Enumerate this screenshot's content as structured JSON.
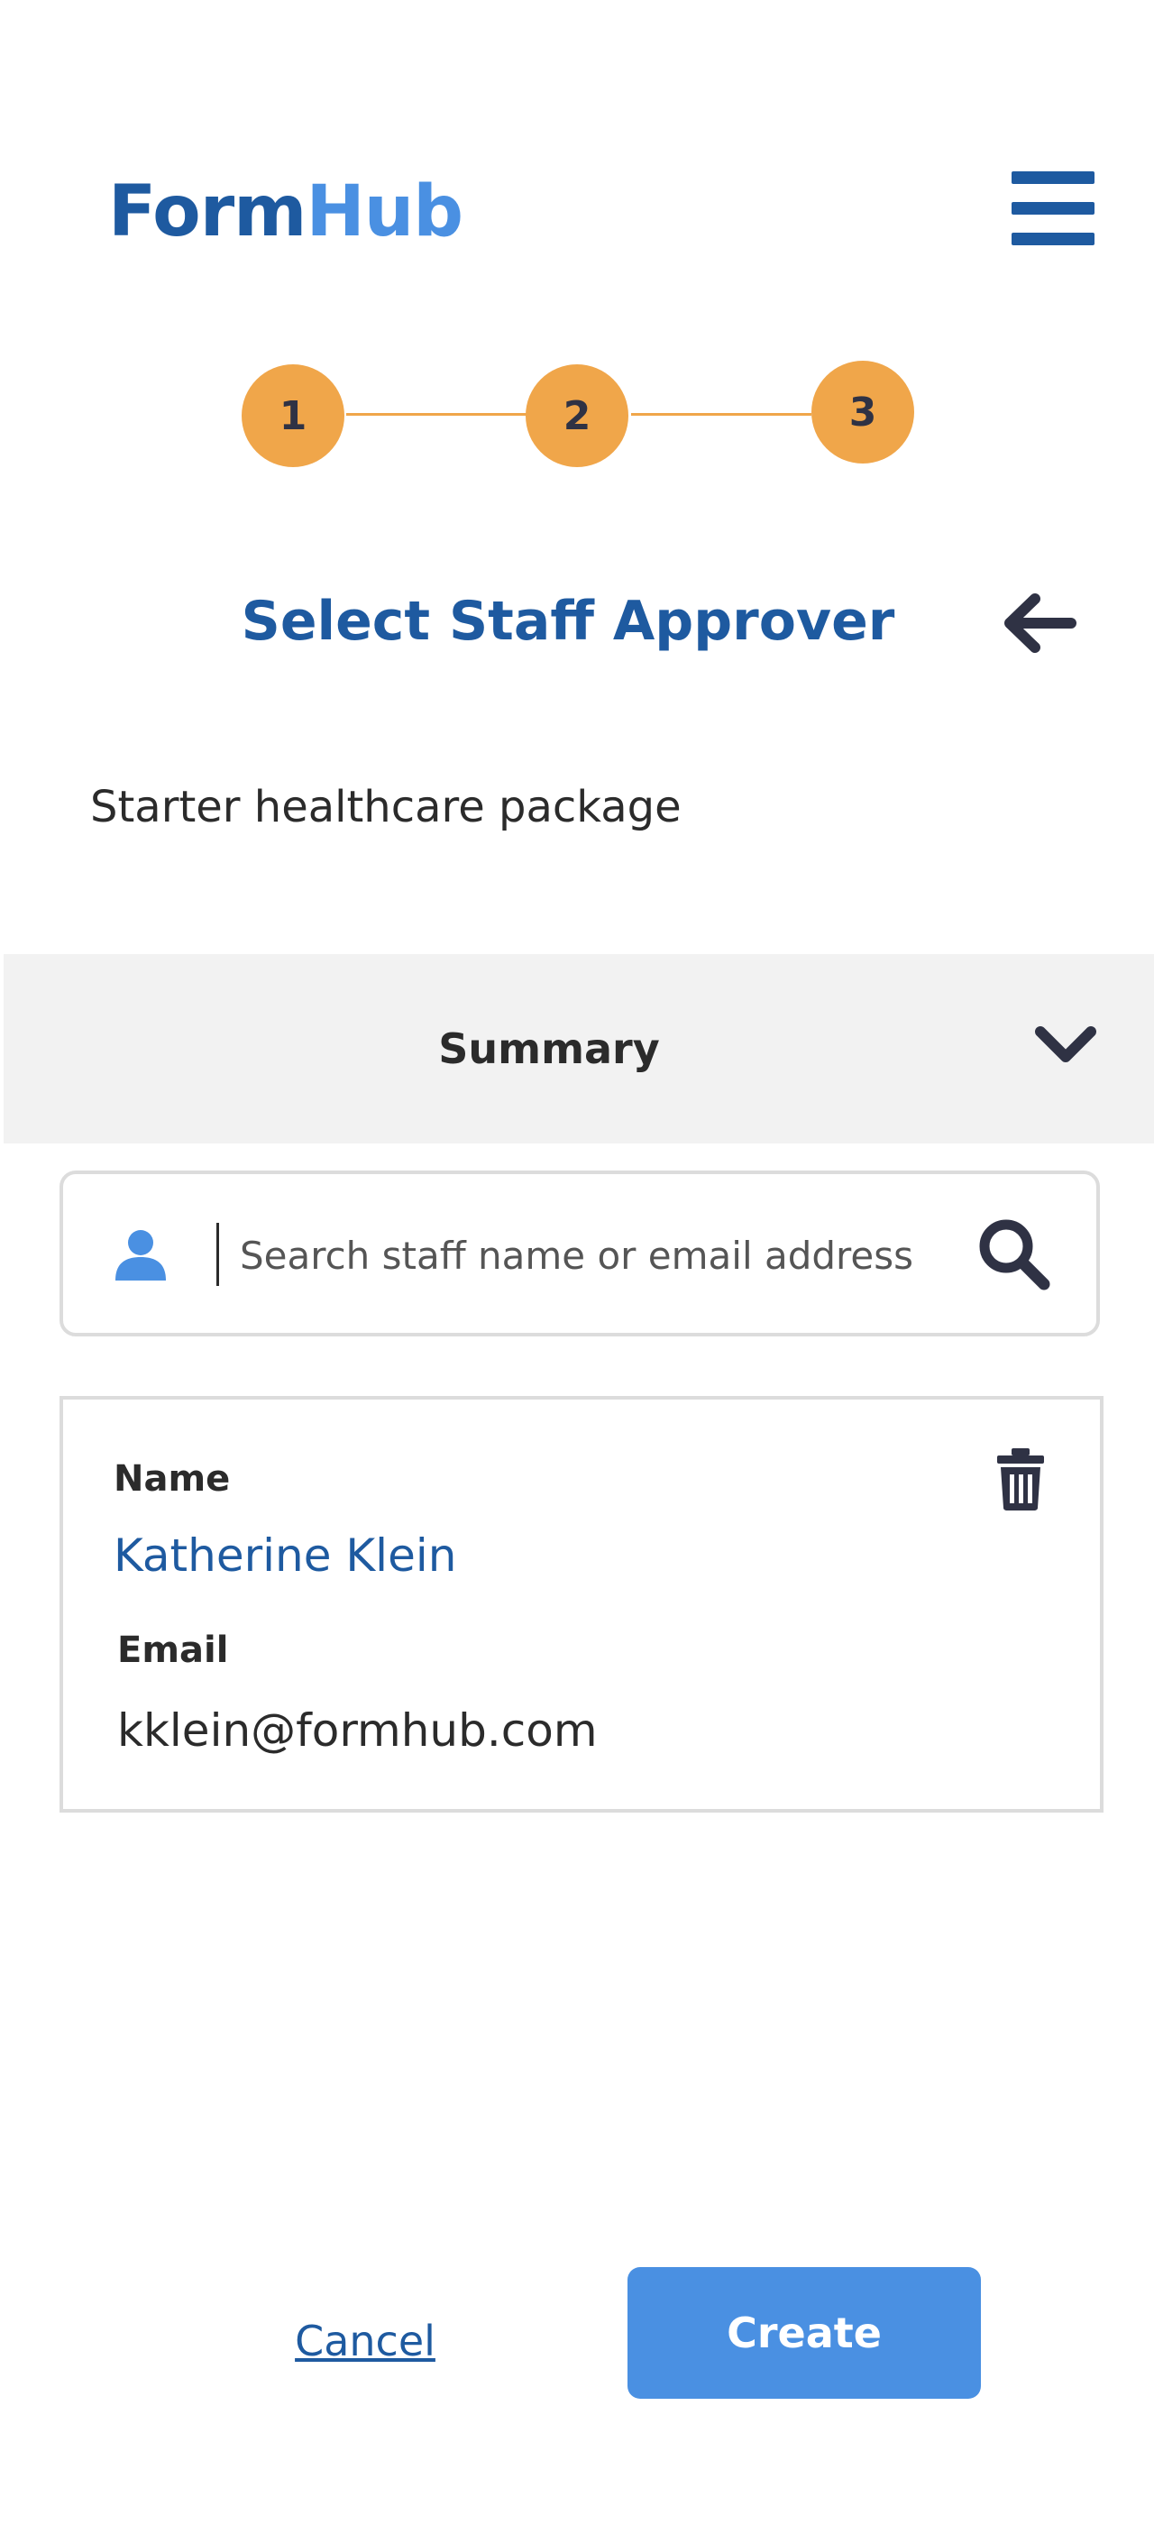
{
  "header": {
    "logo_part1": "Form",
    "logo_part2": "Hub",
    "menu_icon": "hamburger-menu-icon"
  },
  "stepper": {
    "steps": [
      "1",
      "2",
      "3"
    ]
  },
  "page": {
    "title": "Select Staff Approver",
    "subtitle": "Starter healthcare package",
    "back_icon": "arrow-left-icon"
  },
  "summary": {
    "label": "Summary",
    "chevron_icon": "chevron-down-icon"
  },
  "search": {
    "placeholder": "Search staff name or email address",
    "value": "",
    "user_icon": "user-icon",
    "search_icon": "search-icon"
  },
  "approver": {
    "name_label": "Name",
    "name": "Katherine Klein",
    "email_label": "Email",
    "email": "kklein@formhub.com",
    "delete_icon": "trash-icon"
  },
  "actions": {
    "cancel_label": "Cancel",
    "create_label": "Create"
  },
  "colors": {
    "brand_dark": "#1e5aa0",
    "brand_light": "#4a90e2",
    "step": "#f0a64a",
    "summary_bg": "#f2f2f2"
  }
}
